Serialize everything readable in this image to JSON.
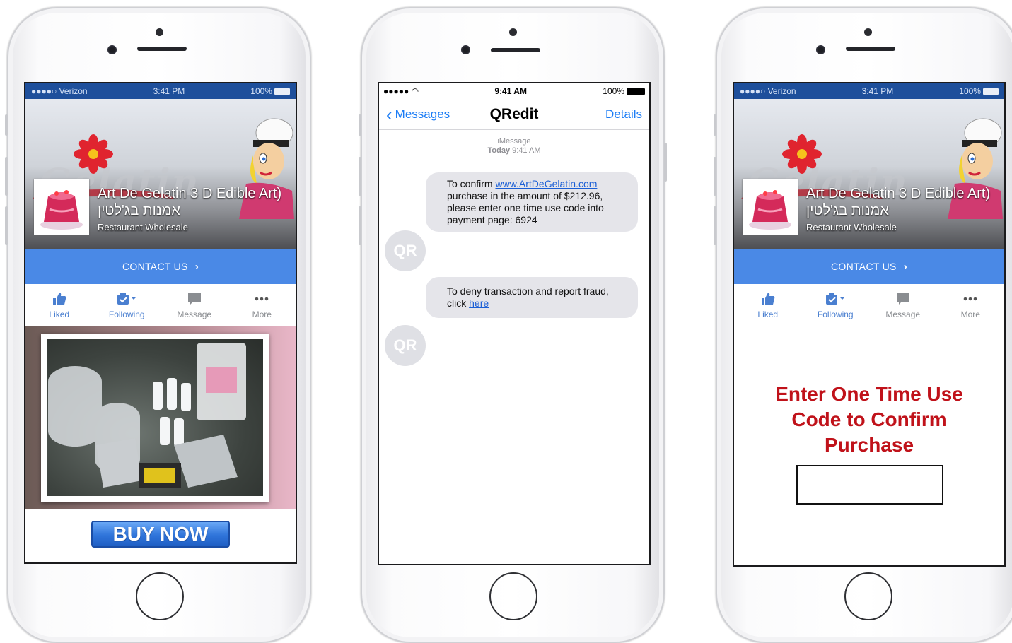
{
  "facebook": {
    "status": {
      "carrier": "●●●●○ Verizon",
      "time": "3:41 PM",
      "battery": "100%"
    },
    "page_name": "Art De Gelatin 3 D Edible Art) אמנות בג'לטין",
    "cover_logo_text": "Gelatin",
    "category": "Restaurant Wholesale",
    "contact_label": "CONTACT US",
    "actions": [
      {
        "label": "Liked"
      },
      {
        "label": "Following"
      },
      {
        "label": "Message"
      },
      {
        "label": "More"
      }
    ],
    "buy_label": "BUY NOW"
  },
  "imessage": {
    "status": {
      "signal": "●●●●● ",
      "time": "9:41 AM",
      "battery": "100%"
    },
    "back_label": "Messages",
    "title": "QRedit",
    "details_label": "Details",
    "meta_service": "iMessage",
    "meta_day": "Today",
    "meta_time": "9:41 AM",
    "message1": {
      "prefix": "To confirm ",
      "link": "www.ArtDeGelatin.com",
      "rest": " purchase in the amount of $212.96, please enter one time use code into payment page: 6924"
    },
    "message2": {
      "prefix": "To deny transaction and report fraud, click ",
      "link": "here"
    },
    "avatar_label": "QR"
  },
  "confirm": {
    "prompt_line1": "Enter One Time Use",
    "prompt_line2": "Code to Confirm",
    "prompt_line3": "Purchase",
    "code_value": ""
  },
  "colors": {
    "facebook_blue": "#4a89e6",
    "ios_blue": "#1b7cf5",
    "prompt_red": "#c0121a"
  },
  "icons": [
    "thumbs-up-icon",
    "follow-check-icon",
    "message-icon",
    "more-dots-icon",
    "chevron-right-icon",
    "chevron-left-icon"
  ]
}
